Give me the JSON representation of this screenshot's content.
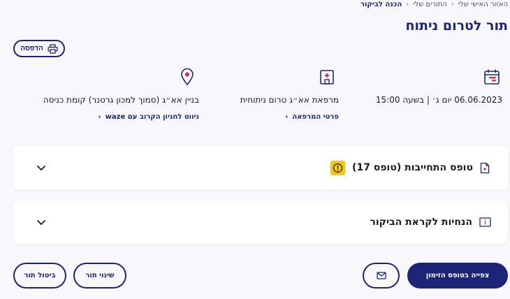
{
  "breadcrumb": {
    "items": [
      "האזור האישי שלי",
      "התורים שלי"
    ],
    "current": "הכנה לביקור"
  },
  "page": {
    "title": "תור לטרום ניתוח",
    "print_label": "הדפסה"
  },
  "details": {
    "datetime": "06.06.2023 יום ג׳ | בשעה 15:00",
    "clinic": "מרפאת אא״ג טרום ניתוחית",
    "clinic_link": "פרטי המרפאה",
    "location": "בניין אא״ג (סמוך למכון גרטנר) קומת כניסה",
    "navigate_link": "ניווט לחניון הקרוב עם waze"
  },
  "cards": {
    "commitment_form": "טופס התחייבות (טופס 17)",
    "visit_instructions": "הנחיות לקראת הביקור"
  },
  "actions": {
    "view_referral": "צפייה בטופס הזימון",
    "change_appointment": "שינוי תור",
    "cancel_appointment": "ביטול תור"
  },
  "colors": {
    "primary": "#1d2475",
    "accent": "#e0245e",
    "warning": "#f5c518"
  },
  "icons": {
    "print": "printer-icon",
    "calendar": "calendar-icon",
    "clinic": "hospital-building-icon",
    "location": "map-pin-icon",
    "document": "document-icon",
    "warning": "warning-icon",
    "instructions": "info-card-icon",
    "mail": "envelope-icon"
  }
}
